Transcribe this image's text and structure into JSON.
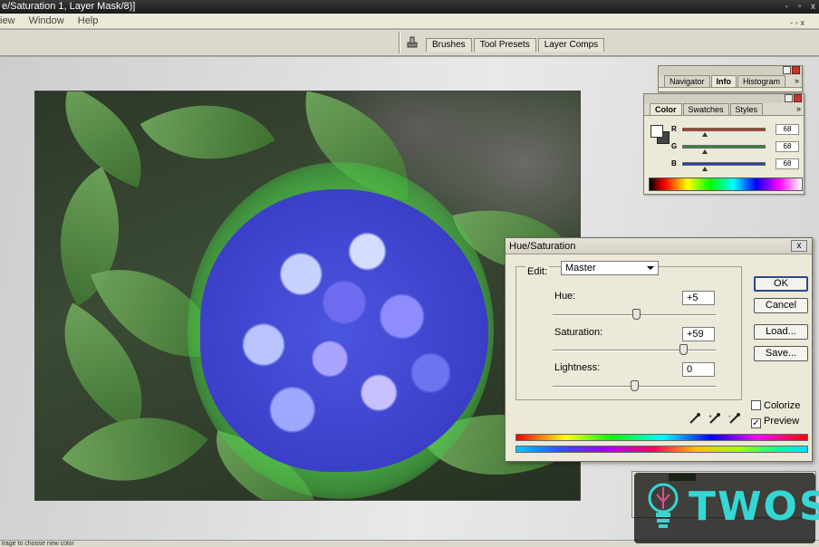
{
  "window": {
    "title": "e/Saturation 1, Layer Mask/8)]",
    "controls": "- ▫ x"
  },
  "menu": {
    "items": [
      "iew",
      "Window",
      "Help"
    ],
    "doc_controls": "- ▫ x"
  },
  "palette_well": {
    "tabs": [
      "Brushes",
      "Tool Presets",
      "Layer Comps"
    ]
  },
  "navigator_panel": {
    "tabs": [
      "Navigator",
      "Info",
      "Histogram"
    ],
    "active_tab": "Info",
    "more": "»"
  },
  "color_panel": {
    "tabs": [
      "Color",
      "Swatches",
      "Styles"
    ],
    "active_tab": "Color",
    "more": "»",
    "channels": [
      {
        "label": "R",
        "value": "68",
        "color": "#c0392b",
        "level": 0.27
      },
      {
        "label": "G",
        "value": "68",
        "color": "#2e8b3a",
        "level": 0.27
      },
      {
        "label": "B",
        "value": "68",
        "color": "#2a3fa8",
        "level": 0.27
      }
    ],
    "foreground_color": "#ffffff",
    "background_color": "#444444"
  },
  "hue_saturation": {
    "title": "Hue/Saturation",
    "close": "x",
    "edit_label": "Edit:",
    "edit_value": "Master",
    "sliders": [
      {
        "label": "Hue:",
        "value": "+5",
        "level": 0.51
      },
      {
        "label": "Saturation:",
        "value": "+59",
        "level": 0.8
      },
      {
        "label": "Lightness:",
        "value": "0",
        "level": 0.5
      }
    ],
    "buttons": {
      "ok": "OK",
      "cancel": "Cancel",
      "load": "Load...",
      "save": "Save..."
    },
    "colorize": {
      "label": "Colorize",
      "checked": false
    },
    "preview": {
      "label": "Preview",
      "checked": true,
      "mark": "✓"
    }
  },
  "status": {
    "text": "lrage to choose new color"
  },
  "watermark": {
    "text": "TWOS"
  }
}
